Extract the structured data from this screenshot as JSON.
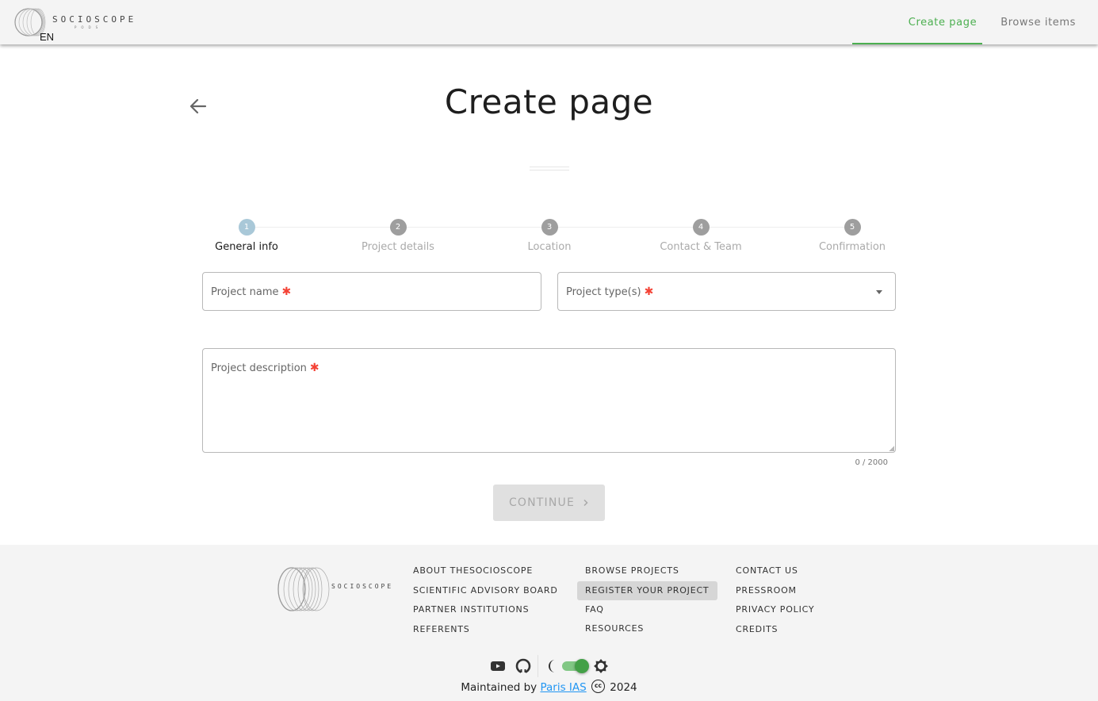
{
  "header": {
    "logo_text": "SOCIOSCOPE",
    "logo_subtext": "PODS",
    "language": "EN",
    "nav": [
      {
        "label": "Create page",
        "active": true
      },
      {
        "label": "Browse items",
        "active": false
      }
    ],
    "accent_color": "#4caf50"
  },
  "main": {
    "back_icon": "arrow-left-icon",
    "title": "Create page",
    "stepper": {
      "current_step": 1,
      "steps": [
        {
          "number": "1",
          "label": "General info"
        },
        {
          "number": "2",
          "label": "Project details"
        },
        {
          "number": "3",
          "label": "Location"
        },
        {
          "number": "4",
          "label": "Contact & Team"
        },
        {
          "number": "5",
          "label": "Confirmation"
        }
      ]
    },
    "form": {
      "project_name": {
        "label": "Project name",
        "value": "",
        "required_mark": "✱"
      },
      "project_types": {
        "label": "Project type(s)",
        "value": "",
        "required_mark": "✱"
      },
      "project_description": {
        "label": "Project description",
        "value": "",
        "required_mark": "✱",
        "counter": "0 / 2000"
      }
    },
    "continue_button": {
      "label": "CONTINUE",
      "icon": "chevron-right-icon",
      "disabled": true
    }
  },
  "footer": {
    "logo_text": "SOCIOSCOPE",
    "columns": [
      [
        "ABOUT THESOCIOSCOPE",
        "SCIENTIFIC ADVISORY BOARD",
        "PARTNER INSTITUTIONS",
        "REFERENTS"
      ],
      [
        "BROWSE PROJECTS",
        "REGISTER YOUR PROJECT",
        "FAQ",
        "RESOURCES"
      ],
      [
        "CONTACT US",
        "PRESSROOM",
        "PRIVACY POLICY",
        "CREDITS"
      ]
    ],
    "highlighted_link": "REGISTER YOUR PROJECT",
    "icons": [
      "youtube-icon",
      "github-icon",
      "moon-icon",
      "theme-toggle",
      "sun-icon"
    ],
    "theme_toggle_on": true,
    "maintained_prefix": "Maintained by",
    "maintained_link": "Paris IAS",
    "license_icon": "cc",
    "year": "2024"
  }
}
